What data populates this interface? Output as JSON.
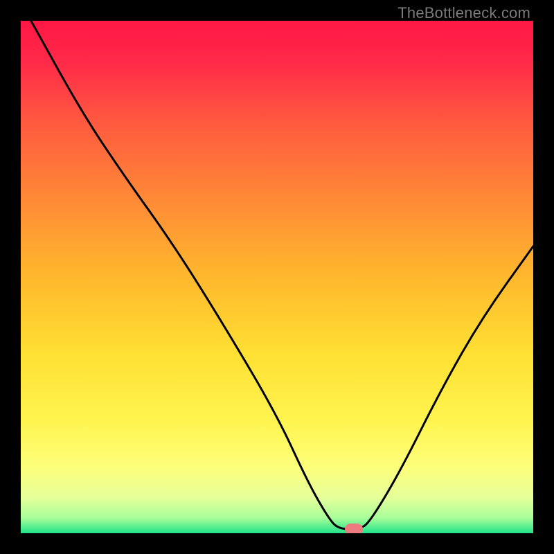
{
  "watermark": "TheBottleneck.com",
  "chart_data": {
    "type": "line",
    "title": "",
    "xlabel": "",
    "ylabel": "",
    "xlim": [
      0,
      100
    ],
    "ylim": [
      0,
      100
    ],
    "grid": false,
    "legend": false,
    "gradient_stops": [
      {
        "offset": 0.0,
        "color": "#ff1744"
      },
      {
        "offset": 0.08,
        "color": "#ff2a49"
      },
      {
        "offset": 0.2,
        "color": "#ff5a3f"
      },
      {
        "offset": 0.35,
        "color": "#ff8a36"
      },
      {
        "offset": 0.5,
        "color": "#ffb82d"
      },
      {
        "offset": 0.65,
        "color": "#ffe033"
      },
      {
        "offset": 0.78,
        "color": "#fff44f"
      },
      {
        "offset": 0.87,
        "color": "#fdff7a"
      },
      {
        "offset": 0.93,
        "color": "#e6ff9a"
      },
      {
        "offset": 0.97,
        "color": "#a8ff9a"
      },
      {
        "offset": 1.0,
        "color": "#21e28a"
      }
    ],
    "series": [
      {
        "name": "bottleneck-curve",
        "color": "#000000",
        "points": [
          {
            "x": 2,
            "y": 100
          },
          {
            "x": 12,
            "y": 82
          },
          {
            "x": 20,
            "y": 70
          },
          {
            "x": 30,
            "y": 56
          },
          {
            "x": 40,
            "y": 40
          },
          {
            "x": 50,
            "y": 23
          },
          {
            "x": 56,
            "y": 10
          },
          {
            "x": 60,
            "y": 3
          },
          {
            "x": 62,
            "y": 0.8
          },
          {
            "x": 66,
            "y": 0.8
          },
          {
            "x": 68,
            "y": 2
          },
          {
            "x": 74,
            "y": 12
          },
          {
            "x": 82,
            "y": 28
          },
          {
            "x": 90,
            "y": 42
          },
          {
            "x": 100,
            "y": 56
          }
        ]
      }
    ],
    "marker": {
      "x": 65,
      "y": 0.8,
      "width": 3.6,
      "height": 2.2,
      "color": "#ee7b80"
    }
  }
}
